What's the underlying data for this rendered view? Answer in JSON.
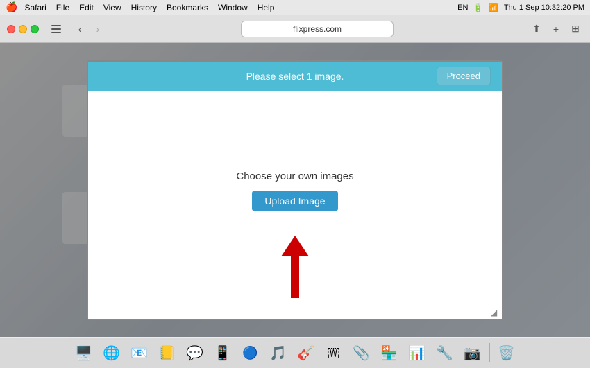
{
  "menubar": {
    "apple": "🍎",
    "items": [
      "Safari",
      "File",
      "Edit",
      "View",
      "History",
      "Bookmarks",
      "Window",
      "Help"
    ],
    "right": {
      "keyboard": "EN",
      "battery": "🔋",
      "wifi": "WiFi",
      "datetime": "Thu 1 Sep  10:32:20 PM"
    }
  },
  "browser": {
    "url": "flixpress.com",
    "reload_label": "↻"
  },
  "modal": {
    "header_title": "Please select 1 image.",
    "proceed_label": "Proceed",
    "choose_label": "Choose your own images",
    "upload_label": "Upload Image"
  },
  "dock": {
    "items": [
      "🖥️",
      "🌐",
      "📧",
      "📒",
      "📱",
      "💬",
      "🔵",
      "🎵",
      "🎸",
      "🇼",
      "📎",
      "🏪",
      "📊",
      "🔧",
      "📷",
      "🗑️"
    ]
  }
}
